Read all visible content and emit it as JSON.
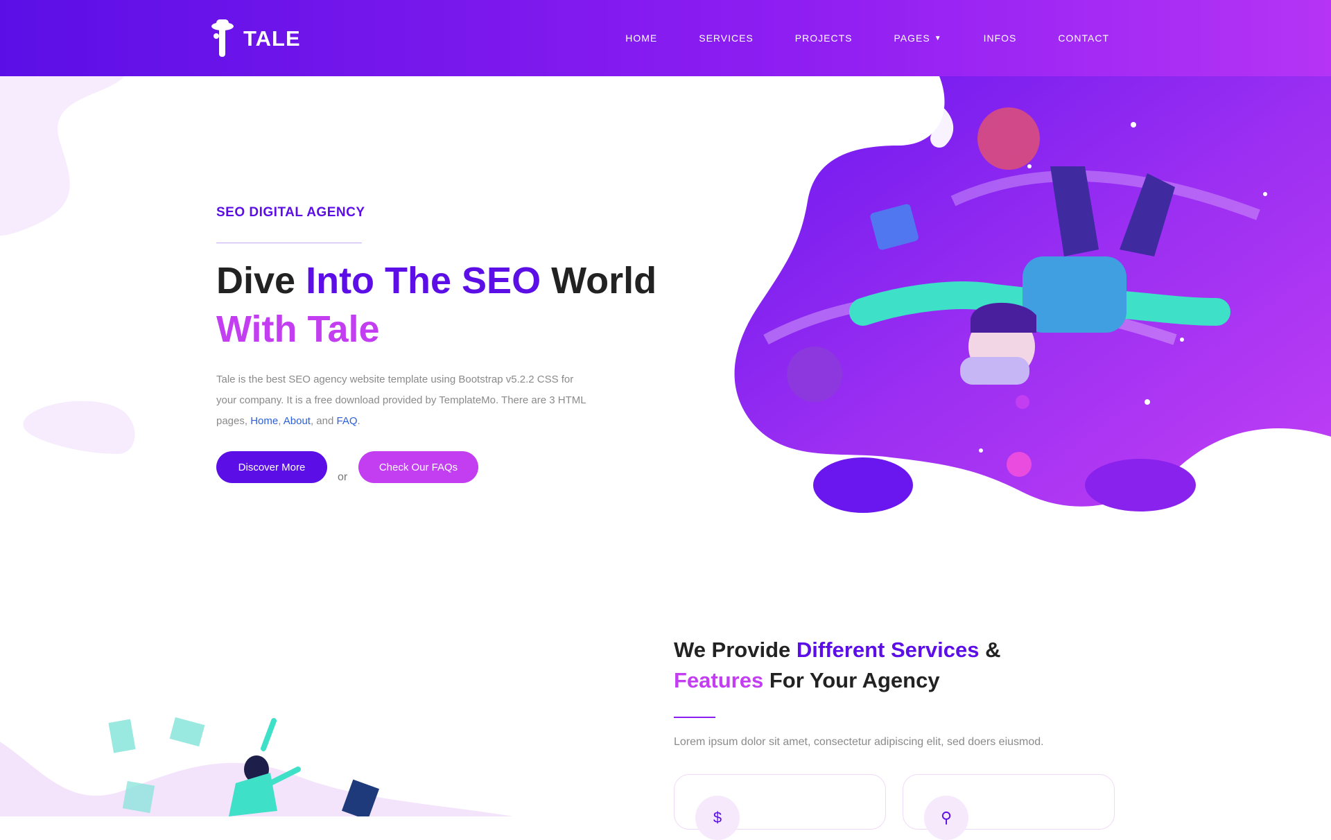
{
  "brand": {
    "name": "TALE"
  },
  "nav": {
    "items": [
      "HOME",
      "SERVICES",
      "PROJECTS",
      "PAGES",
      "INFOS",
      "CONTACT"
    ]
  },
  "hero": {
    "tag": "SEO DIGITAL AGENCY",
    "title_part1": "Dive ",
    "title_part2": "Into The SEO",
    "title_part3": " World",
    "title_part4": " With Tale",
    "desc_text": "Tale is the best SEO agency website template using Bootstrap v5.2.2 CSS for your company. It is a free download provided by TemplateMo. There are 3 HTML pages, ",
    "link_home": "Home",
    "sep1": ", ",
    "link_about": "About",
    "sep2": ", and ",
    "link_faq": "FAQ",
    "end": ".",
    "btn_discover": "Discover More",
    "or": "or",
    "btn_faq": "Check Our FAQs"
  },
  "services": {
    "h_part1": "We Provide ",
    "h_part2": "Different Services",
    "h_part3": " &",
    "h_part4": "Features",
    "h_part5": " For Your Agency",
    "subtitle": "Lorem ipsum dolor sit amet, consectetur adipiscing elit, sed doers eiusmod."
  },
  "colors": {
    "primary": "#5b0fe6",
    "accent": "#c23ef0"
  }
}
